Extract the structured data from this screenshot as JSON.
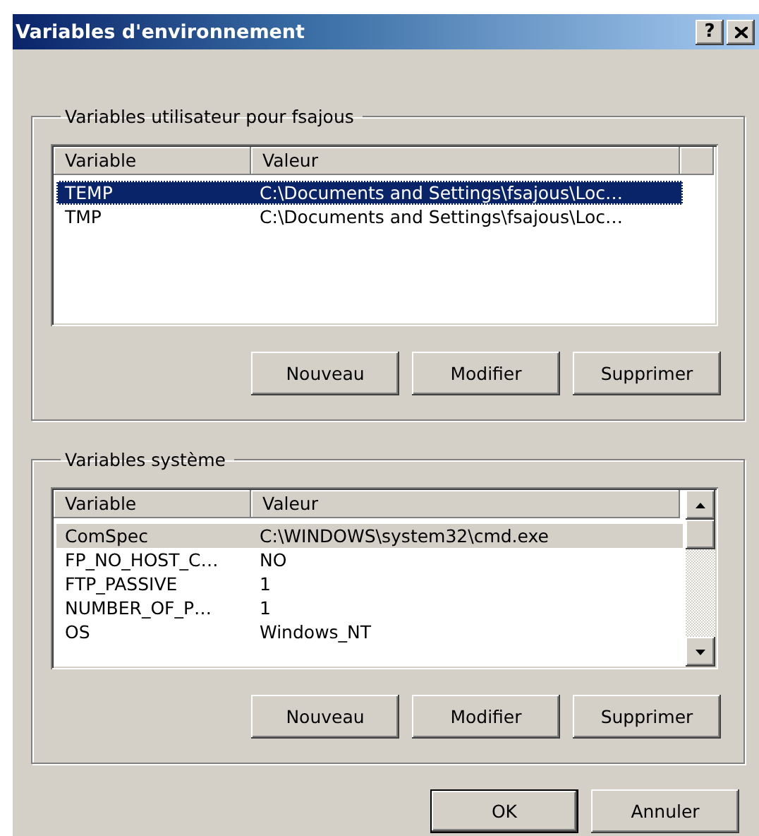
{
  "window": {
    "title": "Variables d'environnement",
    "help_button": "?"
  },
  "user_variables": {
    "label": "Variables utilisateur pour fsajous",
    "focused": true,
    "columns": [
      "Variable",
      "Valeur"
    ],
    "rows": [
      {
        "variable": "TEMP",
        "value": "C:\\Documents and Settings\\fsajous\\Loc…",
        "selected": true
      },
      {
        "variable": "TMP",
        "value": "C:\\Documents and Settings\\fsajous\\Loc…",
        "selected": false
      }
    ],
    "buttons": [
      "Nouveau",
      "Modifier",
      "Supprimer"
    ]
  },
  "system_variables": {
    "label": "Variables système",
    "focused": false,
    "columns": [
      "Variable",
      "Valeur"
    ],
    "rows": [
      {
        "variable": "ComSpec",
        "value": "C:\\WINDOWS\\system32\\cmd.exe",
        "selected": true
      },
      {
        "variable": "FP_NO_HOST_C…",
        "value": "NO",
        "selected": false
      },
      {
        "variable": "FTP_PASSIVE",
        "value": "1",
        "selected": false
      },
      {
        "variable": "NUMBER_OF_P…",
        "value": "1",
        "selected": false
      },
      {
        "variable": "OS",
        "value": "Windows_NT",
        "selected": false
      }
    ],
    "buttons": [
      "Nouveau",
      "Modifier",
      "Supprimer"
    ]
  },
  "dialog_buttons": [
    {
      "label": "OK",
      "default": true
    },
    {
      "label": "Annuler",
      "default": false
    }
  ]
}
